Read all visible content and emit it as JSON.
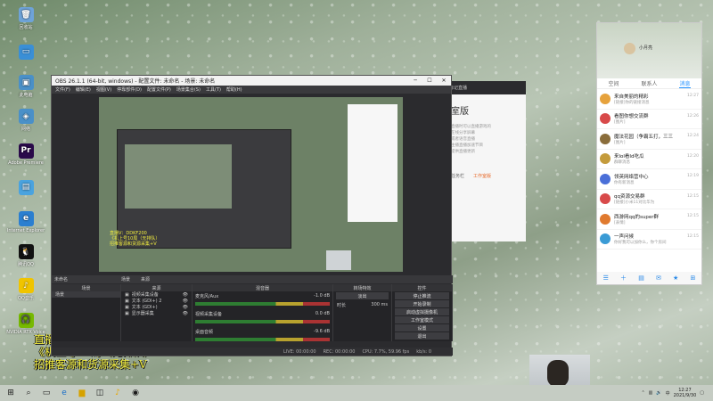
{
  "desktop": {
    "icons": [
      {
        "label": "回收站",
        "color": "#6ea3d8",
        "glyph": "🗑"
      },
      {
        "label": "",
        "color": "#3a8fd6",
        "glyph": "▭"
      },
      {
        "label": "此电脑",
        "color": "#4a90c8",
        "glyph": "▣"
      },
      {
        "label": "网络",
        "color": "#4a90c8",
        "glyph": "◈"
      },
      {
        "label": "Adobe Premiere",
        "color": "#2a0a4a",
        "glyph": "Pr"
      },
      {
        "label": "",
        "color": "#4aa3df",
        "glyph": "▤"
      },
      {
        "label": "Internet Explorer",
        "color": "#2b7fd0",
        "glyph": "e"
      },
      {
        "label": "腾讯QQ",
        "color": "#111111",
        "glyph": "🐧"
      },
      {
        "label": "QQ音乐",
        "color": "#f0c400",
        "glyph": "♪"
      },
      {
        "label": "NVIDIA RTX Voice",
        "color": "#76b900",
        "glyph": "🎧"
      }
    ]
  },
  "overlay": {
    "line1": "直播V：DDKF200",
    "line2": "《机上号10局（无排队）",
    "line3": "招推客源和货源采集+V"
  },
  "obs": {
    "title": "OBS 26.1.1 (64-bit, windows) - 配置文件: 未命名 - 场景: 未命名",
    "menu": [
      "文件(F)",
      "编辑(E)",
      "视图(V)",
      "停靠部件(D)",
      "配置文件(P)",
      "场景集合(S)",
      "工具(T)",
      "帮助(H)"
    ],
    "scene_header": "未命名",
    "scene_tabs": [
      "场景",
      "来源"
    ],
    "docks": {
      "scenes": "场景",
      "sources": "来源",
      "mixer": "混音器",
      "transitions": "转场特效",
      "controls": "控件"
    },
    "scene_item": "场景",
    "sources": [
      "视频采集设备",
      "文本 (GDI+) 2",
      "文本 (GDI+)",
      "显示器采集"
    ],
    "mixer": [
      {
        "name": "麦克风/Aux",
        "db": "-1.0 dB"
      },
      {
        "name": "视频采集设备",
        "db": "0.0 dB"
      },
      {
        "name": "桌面音频",
        "db": "-9.6 dB"
      }
    ],
    "transition": {
      "type": "淡出",
      "duration_label": "时长",
      "duration": "300 ms"
    },
    "controls": [
      "停止推流",
      "开始录制",
      "启动虚拟摄像机",
      "工作室模式",
      "设置",
      "退出"
    ],
    "status": {
      "live": "LIVE: 00:00:00",
      "rec": "REC: 00:00:00",
      "cpu": "CPU: 7.7%, 59.96 fps",
      "kbps": "kb/s: 0"
    }
  },
  "backwin": {
    "header": "标记直播",
    "heading": "室版",
    "lines": [
      "直播时可以直播游戏的",
      "在线分享屏幕",
      "或者语音直播",
      "主播直播加速节目",
      "提供直播更新"
    ],
    "btn1": "任务栏",
    "btn2": "工作室版"
  },
  "chat": {
    "profile_name": "小月亮",
    "tabs": [
      "空间",
      "联系人",
      "消息"
    ],
    "active_tab": 2,
    "messages": [
      {
        "title": "来自美丽的精彩",
        "preview": "[链接]你的链接消息",
        "time": "12:27",
        "color": "#e6a23c"
      },
      {
        "title": "看图你想交流群",
        "preview": "[图片]",
        "time": "12:26",
        "color": "#d84a4a"
      },
      {
        "title": "魔法花园（争霸五打，三三",
        "preview": "[图片]",
        "time": "12:24",
        "color": "#8a6d3b"
      },
      {
        "title": "来lol看Id吃瓜",
        "preview": "群聊消息",
        "time": "12:20",
        "color": "#c49b3c"
      },
      {
        "title": "领英网络营中心",
        "preview": "你有新消息",
        "time": "12:19",
        "color": "#4a6fd8"
      },
      {
        "title": "qq资源交易群",
        "preview": "[链接]小米11对比华为",
        "time": "12:15",
        "color": "#d84a4a"
      },
      {
        "title": "西游网qq的super群",
        "preview": "[表情]",
        "time": "12:15",
        "color": "#e07a2f"
      },
      {
        "title": "一声问候",
        "preview": "你好我可以加你么，你个房间",
        "time": "12:15",
        "color": "#3a9bd5"
      }
    ]
  },
  "taskbar": {
    "time": "12:27",
    "date": "2021/9/30",
    "lang": "中"
  }
}
